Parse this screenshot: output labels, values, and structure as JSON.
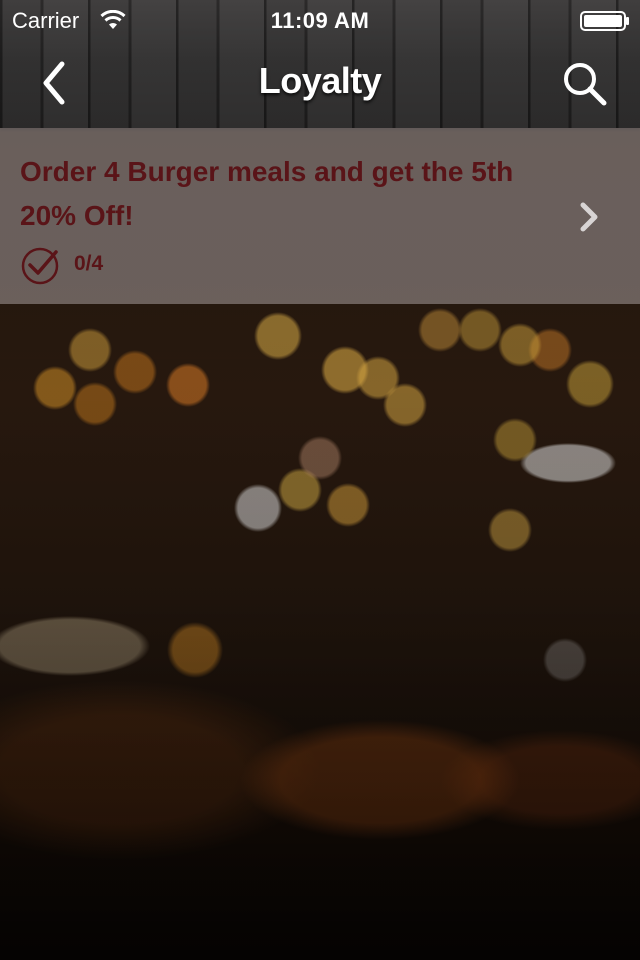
{
  "status_bar": {
    "carrier": "Carrier",
    "time": "11:09 AM",
    "wifi_icon": "wifi-icon",
    "battery_icon": "battery-icon"
  },
  "nav": {
    "title": "Loyalty",
    "back_icon": "chevron-left-icon",
    "search_icon": "search-icon"
  },
  "loyalty_items": [
    {
      "title": "Order 4 Burger meals and get the 5th\n20% Off!",
      "progress": "0/4",
      "progress_fraction": 0,
      "check_icon": "check-circle-icon",
      "chevron_icon": "chevron-right-icon"
    }
  ],
  "colors": {
    "accent_text": "#5a1418",
    "header_bg": "#2b2a2a",
    "row_bg": "#968c8c"
  }
}
